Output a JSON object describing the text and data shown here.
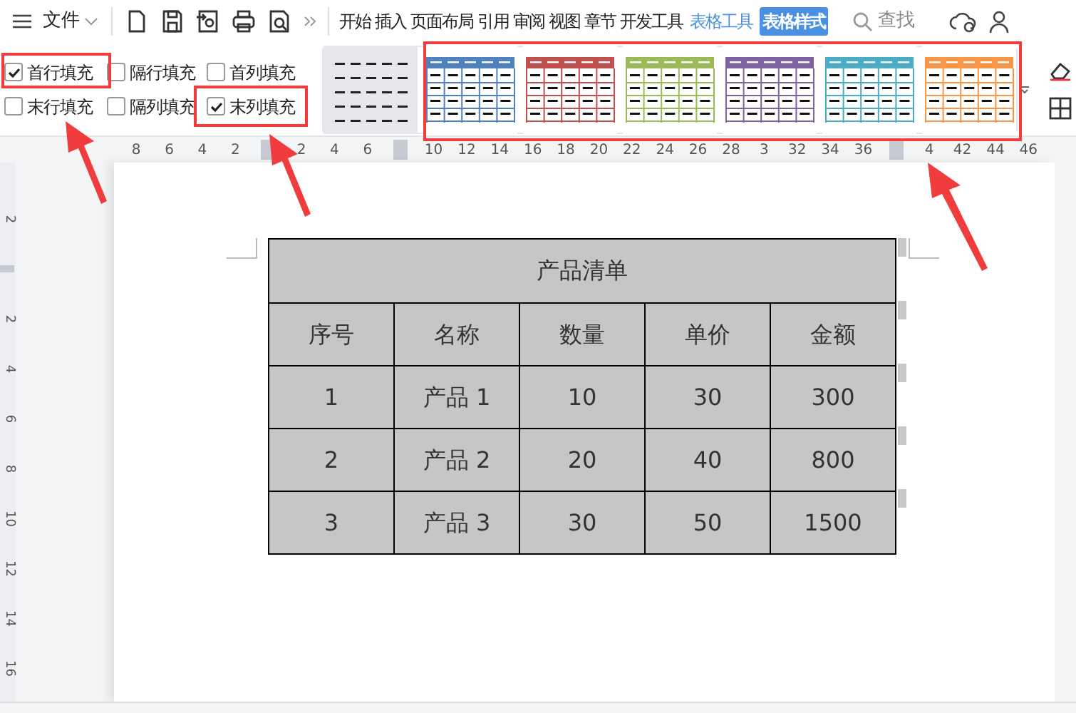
{
  "menu": {
    "label": "文件"
  },
  "tabs": [
    {
      "label": "开始",
      "selected": false,
      "kind": "plain"
    },
    {
      "label": "插入",
      "selected": false,
      "kind": "plain"
    },
    {
      "label": "页面布局",
      "selected": false,
      "kind": "plain"
    },
    {
      "label": "引用",
      "selected": false,
      "kind": "plain"
    },
    {
      "label": "审阅",
      "selected": false,
      "kind": "plain"
    },
    {
      "label": "视图",
      "selected": false,
      "kind": "plain"
    },
    {
      "label": "章节",
      "selected": false,
      "kind": "plain"
    },
    {
      "label": "开发工具",
      "selected": false,
      "kind": "plain"
    },
    {
      "label": "表格工具",
      "selected": false,
      "kind": "context"
    },
    {
      "label": "表格样式",
      "selected": true,
      "kind": "context"
    }
  ],
  "search": {
    "label": "查找"
  },
  "options": [
    {
      "label": "首行填充",
      "checked": true
    },
    {
      "label": "隔行填充",
      "checked": false
    },
    {
      "label": "首列填充",
      "checked": false
    },
    {
      "label": "末行填充",
      "checked": false
    },
    {
      "label": "隔列填充",
      "checked": false
    },
    {
      "label": "末列填充",
      "checked": true
    }
  ],
  "table_styles": [
    {
      "kind": "plain",
      "selected": true
    },
    {
      "kind": "banded",
      "color": "#4f81bd",
      "selected": false
    },
    {
      "kind": "banded",
      "color": "#c0504d",
      "selected": false
    },
    {
      "kind": "banded",
      "color": "#9bbb59",
      "selected": false
    },
    {
      "kind": "banded",
      "color": "#8064a2",
      "selected": false
    },
    {
      "kind": "banded",
      "color": "#4bacc6",
      "selected": false
    },
    {
      "kind": "banded",
      "color": "#f79646",
      "selected": false
    }
  ],
  "ruler": [
    {
      "kind": "number",
      "label": "8"
    },
    {
      "kind": "number",
      "label": "6"
    },
    {
      "kind": "number",
      "label": "4"
    },
    {
      "kind": "number",
      "label": "2"
    },
    {
      "kind": "marker"
    },
    {
      "kind": "number",
      "label": "2"
    },
    {
      "kind": "number",
      "label": "4"
    },
    {
      "kind": "number",
      "label": "6"
    },
    {
      "kind": "marker"
    },
    {
      "kind": "number",
      "label": "10"
    },
    {
      "kind": "number",
      "label": "12"
    },
    {
      "kind": "number",
      "label": "14"
    },
    {
      "kind": "number",
      "label": "16"
    },
    {
      "kind": "number",
      "label": "18"
    },
    {
      "kind": "number",
      "label": "20"
    },
    {
      "kind": "number",
      "label": "22"
    },
    {
      "kind": "number",
      "label": "24"
    },
    {
      "kind": "number",
      "label": "26"
    },
    {
      "kind": "number",
      "label": "28"
    },
    {
      "kind": "number",
      "label": "3"
    },
    {
      "kind": "number",
      "label": "32"
    },
    {
      "kind": "number",
      "label": "34"
    },
    {
      "kind": "number",
      "label": "36"
    },
    {
      "kind": "marker"
    },
    {
      "kind": "number",
      "label": "4"
    },
    {
      "kind": "number",
      "label": "42"
    },
    {
      "kind": "number",
      "label": "44"
    },
    {
      "kind": "number",
      "label": "46"
    }
  ],
  "vertical_ruler": [
    {
      "kind": "number",
      "label": "2"
    },
    {
      "kind": "marker"
    },
    {
      "kind": "number",
      "label": "2"
    },
    {
      "kind": "number",
      "label": "4"
    },
    {
      "kind": "number",
      "label": "6"
    },
    {
      "kind": "number",
      "label": "8"
    },
    {
      "kind": "number",
      "label": "10"
    },
    {
      "kind": "number",
      "label": "12"
    },
    {
      "kind": "number",
      "label": "14"
    },
    {
      "kind": "number",
      "label": "16"
    }
  ],
  "table": {
    "title": "产品清单",
    "columns": [
      "序号",
      "名称",
      "数量",
      "单价",
      "金额"
    ],
    "rows": [
      [
        "1",
        "产品 1",
        "10",
        "30",
        "300"
      ],
      [
        "2",
        "产品 2",
        "20",
        "40",
        "800"
      ],
      [
        "3",
        "产品 3",
        "30",
        "50",
        "1500"
      ]
    ]
  }
}
